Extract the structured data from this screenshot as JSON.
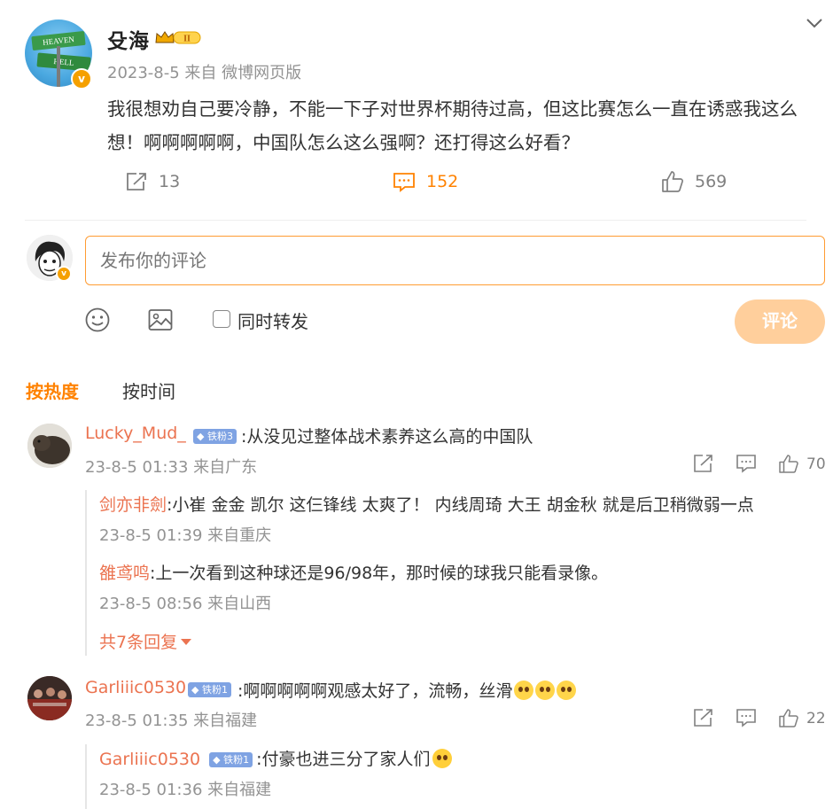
{
  "post": {
    "author": "殳海",
    "vip_level": "II",
    "meta": "2023-8-5 来自 微博网页版",
    "text": "我很想劝自己要冷静，不能一下子对世界杯期待过高，但这比赛怎么一直在诱惑我这么想！啊啊啊啊啊，中国队怎么这么强啊？还打得这么好看？",
    "avatar_sign_top": "HEAVEN",
    "avatar_sign_bottom": "HELL",
    "stats": {
      "reposts": "13",
      "comments": "152",
      "likes": "569"
    }
  },
  "composer": {
    "placeholder": "发布你的评论",
    "repost_label": "同时转发",
    "submit_label": "评论"
  },
  "sort": {
    "hot": "按热度",
    "time": "按时间"
  },
  "comments": [
    {
      "name": "Lucky_Mud_",
      "fan_badge": "铁粉3",
      "text": ":从没见过整体战术素养这么高的中国队",
      "meta": "23-8-5 01:33 来自广东",
      "likes": "70",
      "replies": [
        {
          "name": "剑亦非劍",
          "text": ":小崔 金金 凯尔 这仨锋线 太爽了！ 内线周琦 大王 胡金秋  就是后卫稍微弱一点",
          "meta": "23-8-5 01:39 来自重庆"
        },
        {
          "name": "雒鸢鸣",
          "text": ":上一次看到这种球还是96/98年，那时候的球我只能看录像。",
          "meta": "23-8-5 08:56 来自山西"
        }
      ],
      "more_replies": "共7条回复"
    },
    {
      "name": "Garliiic0530",
      "fan_badge": "铁粉1",
      "text": ":啊啊啊啊啊观感太好了，流畅，丝滑",
      "meta": "23-8-5 01:35 来自福建",
      "likes": "22",
      "replies": [
        {
          "name": "Garliiic0530",
          "fan_badge": "铁粉1",
          "text": ":付豪也进三分了家人们",
          "meta": "23-8-5 01:36 来自福建"
        }
      ]
    }
  ],
  "colors": {
    "accent": "#ff8200",
    "username": "#eb7350",
    "meta": "#939393",
    "submit_disabled": "#ffcf9c"
  }
}
